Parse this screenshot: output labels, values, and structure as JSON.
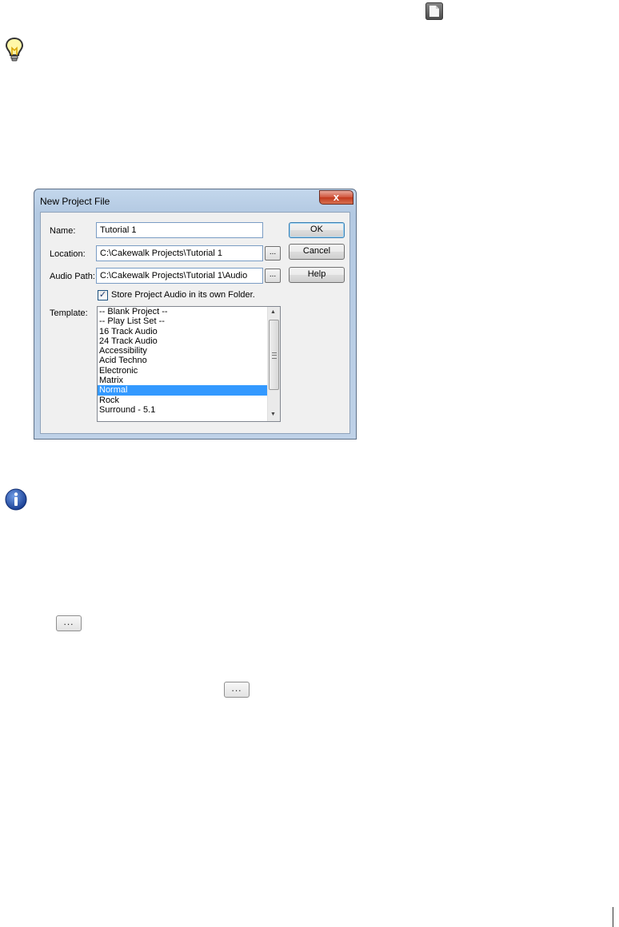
{
  "dialog": {
    "title": "New Project File",
    "close_label": "x",
    "name_label": "Name:",
    "name_value": "Tutorial 1",
    "location_label": "Location:",
    "location_value": "C:\\Cakewalk Projects\\Tutorial 1",
    "audio_path_label": "Audio Path:",
    "audio_path_value": "C:\\Cakewalk Projects\\Tutorial 1\\Audio",
    "browse_label": "...",
    "store_audio_label": "Store Project Audio in its own Folder.",
    "store_audio_checked": true,
    "template_label": "Template:",
    "template_items": [
      "-- Blank Project --",
      "-- Play List Set --",
      "16 Track Audio",
      "24 Track Audio",
      "Accessibility",
      "Acid Techno",
      "Electronic",
      "Matrix",
      "Normal",
      "Rock",
      "Surround - 5.1"
    ],
    "selected_template": "Normal",
    "buttons": {
      "ok": "OK",
      "cancel": "Cancel",
      "help": "Help"
    }
  },
  "page": {
    "ellipsis_button_1": "...",
    "ellipsis_button_2": "..."
  }
}
